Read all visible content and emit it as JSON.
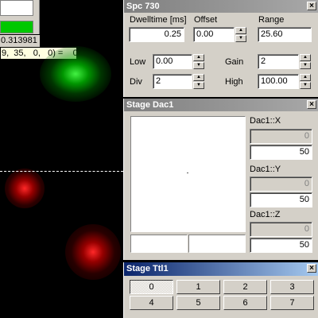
{
  "viewer": {
    "value_readout": "0.313981",
    "pixel_tooltip": "9,  35,   0,   0) =    0"
  },
  "spc": {
    "title": "Spc 730",
    "dwell_label": "Dwelltime [ms]",
    "dwell_value": "0.25",
    "offset_label": "Offset",
    "offset_value": "0.00",
    "range_label": "Range",
    "range_value": "25.60",
    "low_label": "Low",
    "low_value": "0.00",
    "gain_label": "Gain",
    "gain_value": "2",
    "div_label": "Div",
    "div_value": "2",
    "high_label": "High",
    "high_value": "100.00"
  },
  "dac": {
    "title": "Stage Dac1",
    "x_label": "Dac1::X",
    "x_current": "0",
    "x_value": "50",
    "y_label": "Dac1::Y",
    "y_current": "0",
    "y_value": "50",
    "z_label": "Dac1::Z",
    "z_current": "0",
    "z_value": "50"
  },
  "ttl": {
    "title": "Stage Ttl1",
    "buttons": [
      "0",
      "1",
      "2",
      "3",
      "4",
      "5",
      "6",
      "7"
    ],
    "selected": 0
  },
  "close_glyph": "×",
  "spin_up": "▲",
  "spin_down": "▼"
}
